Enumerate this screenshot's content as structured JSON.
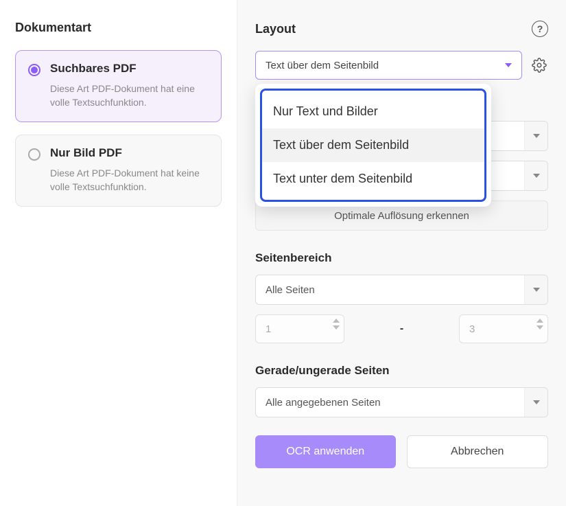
{
  "left": {
    "title": "Dokumentart",
    "options": [
      {
        "title": "Suchbares PDF",
        "desc": "Diese Art PDF-Dokument hat eine volle Textsuchfunktion.",
        "selected": true
      },
      {
        "title": "Nur Bild PDF",
        "desc": "Diese Art PDF-Dokument hat keine volle Textsuchfunktion.",
        "selected": false
      }
    ]
  },
  "right": {
    "layout_title": "Layout",
    "layout_selected": "Text über dem Seitenbild",
    "layout_options": [
      "Nur Text und Bilder",
      "Text über dem Seitenbild",
      "Text unter dem Seitenbild"
    ],
    "detect_resolution": "Optimale Auflösung erkennen",
    "page_range_title": "Seitenbereich",
    "page_range_selected": "Alle Seiten",
    "page_from": "1",
    "page_to": "3",
    "odd_even_title": "Gerade/ungerade Seiten",
    "odd_even_selected": "Alle angegebenen Seiten",
    "apply": "OCR anwenden",
    "cancel": "Abbrechen"
  }
}
